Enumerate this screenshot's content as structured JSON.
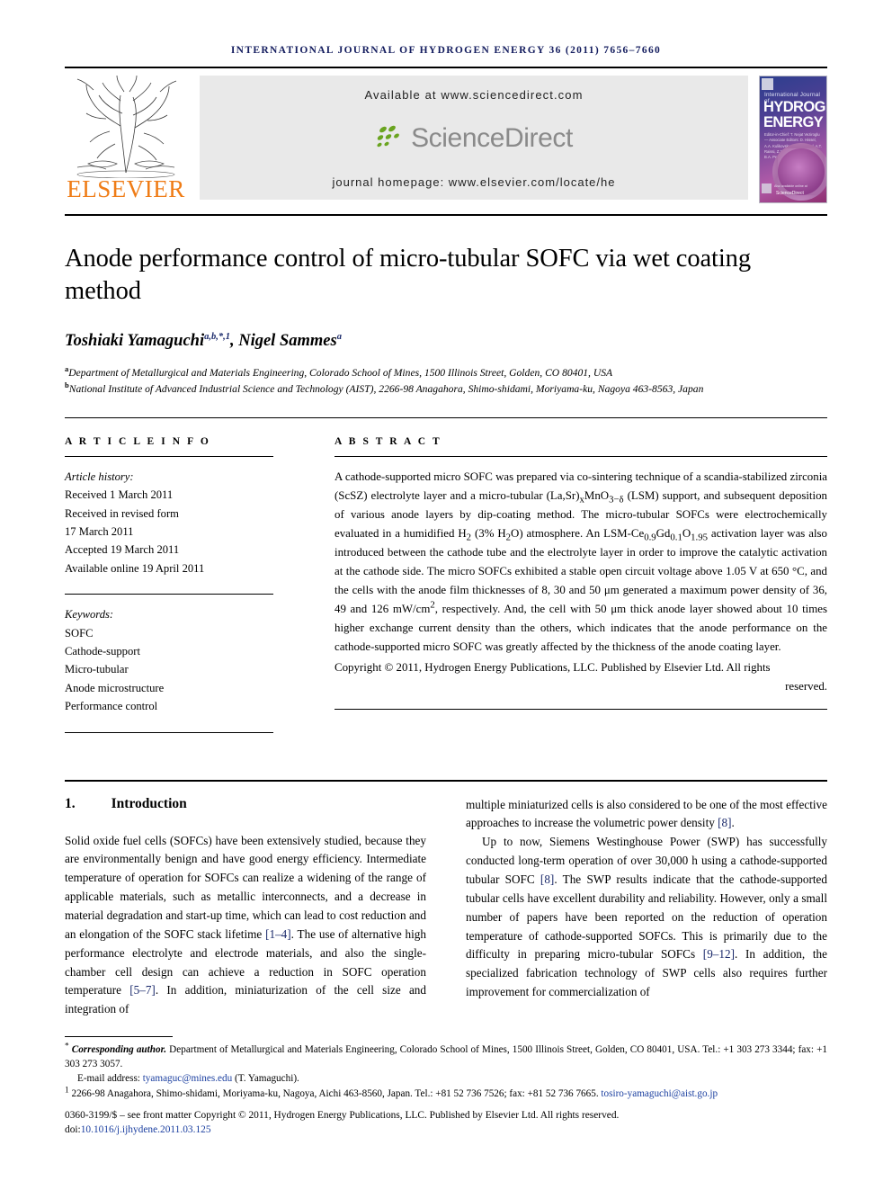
{
  "running_head": "International Journal of Hydrogen Energy 36 (2011) 7656–7660",
  "masthead": {
    "publisher": "ELSEVIER",
    "available_at": "Available at www.sciencedirect.com",
    "sciencedirect_word": "ScienceDirect",
    "journal_homepage": "journal homepage: www.elsevier.com/locate/he",
    "cover": {
      "line1": "International Journal of",
      "line2": "HYDROGEN",
      "line3": "ENERGY",
      "editors": "Editor-in-Chief: T. Nejat Veziroglu — Associate Editors: D. Hissel, A.A. Kulikovsky, A.M. Seayad, A.T. Raissi, Z.X. Liu, C.A. Goad and B.A. Peppley",
      "sd_label": "ScienceDirect",
      "sd_note": "Also available online at"
    }
  },
  "title": "Anode performance control of micro-tubular SOFC via wet coating method",
  "authors": {
    "author1_name": "Toshiaki Yamaguchi",
    "author1_sup": "a,b,*,1",
    "separator": ", ",
    "author2_name": "Nigel Sammes",
    "author2_sup": "a"
  },
  "affiliations": [
    {
      "marker": "a",
      "text": "Department of Metallurgical and Materials Engineering, Colorado School of Mines, 1500 Illinois Street, Golden, CO 80401, USA"
    },
    {
      "marker": "b",
      "text": "National Institute of Advanced Industrial Science and Technology (AIST), 2266-98 Anagahora, Shimo-shidami, Moriyama-ku, Nagoya 463-8563, Japan"
    }
  ],
  "article_info": {
    "heading": "A R T I C L E  I N F O",
    "history_label": "Article history:",
    "history": [
      "Received 1 March 2011",
      "Received in revised form",
      "17 March 2011",
      "Accepted 19 March 2011",
      "Available online 19 April 2011"
    ],
    "keywords_label": "Keywords:",
    "keywords": [
      "SOFC",
      "Cathode-support",
      "Micro-tubular",
      "Anode microstructure",
      "Performance control"
    ]
  },
  "abstract": {
    "heading": "A B S T R A C T",
    "paragraph_1": "A cathode-supported micro SOFC was prepared via co-sintering technique of a scandia-stabilized zirconia (ScSZ) electrolyte layer and a micro-tubular (La,Sr)",
    "formula_lsm_sub1": "x",
    "paragraph_1b": "MnO",
    "formula_lsm_sub2": "3−δ",
    "paragraph_1c": " (LSM) support, and subsequent deposition of various anode layers by dip-coating method. The micro-tubular SOFCs were electrochemically evaluated in a humidified H",
    "h2_sub": "2",
    "paragraph_1d": " (3% H",
    "h2o_sub": "2",
    "paragraph_1e": "O) atmosphere. An LSM-Ce",
    "ce_sub": "0.9",
    "paragraph_1f": "Gd",
    "gd_sub": "0.1",
    "paragraph_1g": "O",
    "o_sub": "1.95",
    "paragraph_1h": " activation layer was also introduced between the cathode tube and the electrolyte layer in order to improve the catalytic activation at the cathode side. The micro SOFCs exhibited a stable open circuit voltage above 1.05 V at 650 °C, and the cells with the anode film thicknesses of 8, 30 and 50 μm generated a maximum power density of 36, 49 and 126 mW/cm",
    "cm2_sup": "2",
    "paragraph_1i": ", respectively. And, the cell with 50 μm thick anode layer showed about 10 times higher exchange current density than the others, which indicates that the anode performance on the cathode-supported micro SOFC was greatly affected by the thickness of the anode coating layer.",
    "copyright_main": "Copyright © 2011, Hydrogen Energy Publications, LLC. Published by Elsevier Ltd. All rights",
    "copyright_last": "reserved."
  },
  "body": {
    "section_number": "1.",
    "section_title": "Introduction",
    "left_paragraph_1_a": "Solid oxide fuel cells (SOFCs) have been extensively studied, because they are environmentally benign and have good energy efficiency. Intermediate temperature of operation for SOFCs can realize a widening of the range of applicable materials, such as metallic interconnects, and a decrease in material degradation and start-up time, which can lead to cost reduction and an elongation of the SOFC stack lifetime ",
    "ref_1_4": "[1–4]",
    "left_paragraph_1_b": ". The use of alternative high performance electrolyte and electrode materials, and also the single-chamber cell design can achieve a reduction in SOFC operation temperature ",
    "ref_5_7": "[5–7]",
    "left_paragraph_1_c": ". In addition, miniaturization of the cell size and integration of ",
    "right_paragraph_1_a": "multiple miniaturized cells is also considered to be one of the most effective approaches to increase the volumetric power density ",
    "ref_8a": "[8]",
    "right_paragraph_1_b": ".",
    "right_paragraph_2_a": "Up to now, Siemens Westinghouse Power (SWP) has successfully conducted long-term operation of over 30,000 h using a cathode-supported tubular SOFC ",
    "ref_8b": "[8]",
    "right_paragraph_2_b": ". The SWP results indicate that the cathode-supported tubular cells have excellent durability and reliability. However, only a small number of papers have been reported on the reduction of operation temperature of cathode-supported SOFCs. This is primarily due to the difficulty in preparing micro-tubular SOFCs ",
    "ref_9_12": "[9–12]",
    "right_paragraph_2_c": ". In addition, the specialized fabrication technology of SWP cells also requires further improvement for commercialization of"
  },
  "footnotes": {
    "corresponding_marker": "*",
    "corresponding_label": "Corresponding author.",
    "corresponding_text": " Department of Metallurgical and Materials Engineering, Colorado School of Mines, 1500 Illinois Street, Golden, CO 80401, USA. Tel.: +1 303 273 3344; fax: +1 303 273 3057.",
    "email_label": "E-mail address:",
    "email_link": "tyamaguc@mines.edu",
    "email_suffix": " (T. Yamaguchi).",
    "note1_marker": "1",
    "note1_text": " 2266-98 Anagahora, Shimo-shidami, Moriyama-ku, Nagoya, Aichi 463-8560, Japan. Tel.: +81 52 736 7526; fax: +81 52 736 7665. ",
    "note1_link": "tosiro-yamaguchi@aist.go.jp",
    "issn_copyright": "0360-3199/$ – see front matter Copyright © 2011, Hydrogen Energy Publications, LLC. Published by Elsevier Ltd. All rights reserved.",
    "doi_label": "doi:",
    "doi_value": "10.1016/j.ijhydene.2011.03.125"
  },
  "colors": {
    "running_head": "#131c5e",
    "elsevier_orange": "#ef7c16",
    "sciencedirect_gray": "#8a8a8a",
    "sciencedirect_green": "#6aa420",
    "link_blue": "#1b3fa0",
    "reference_blue": "#1b2a6b",
    "panel_gray": "#e9e9e9"
  }
}
